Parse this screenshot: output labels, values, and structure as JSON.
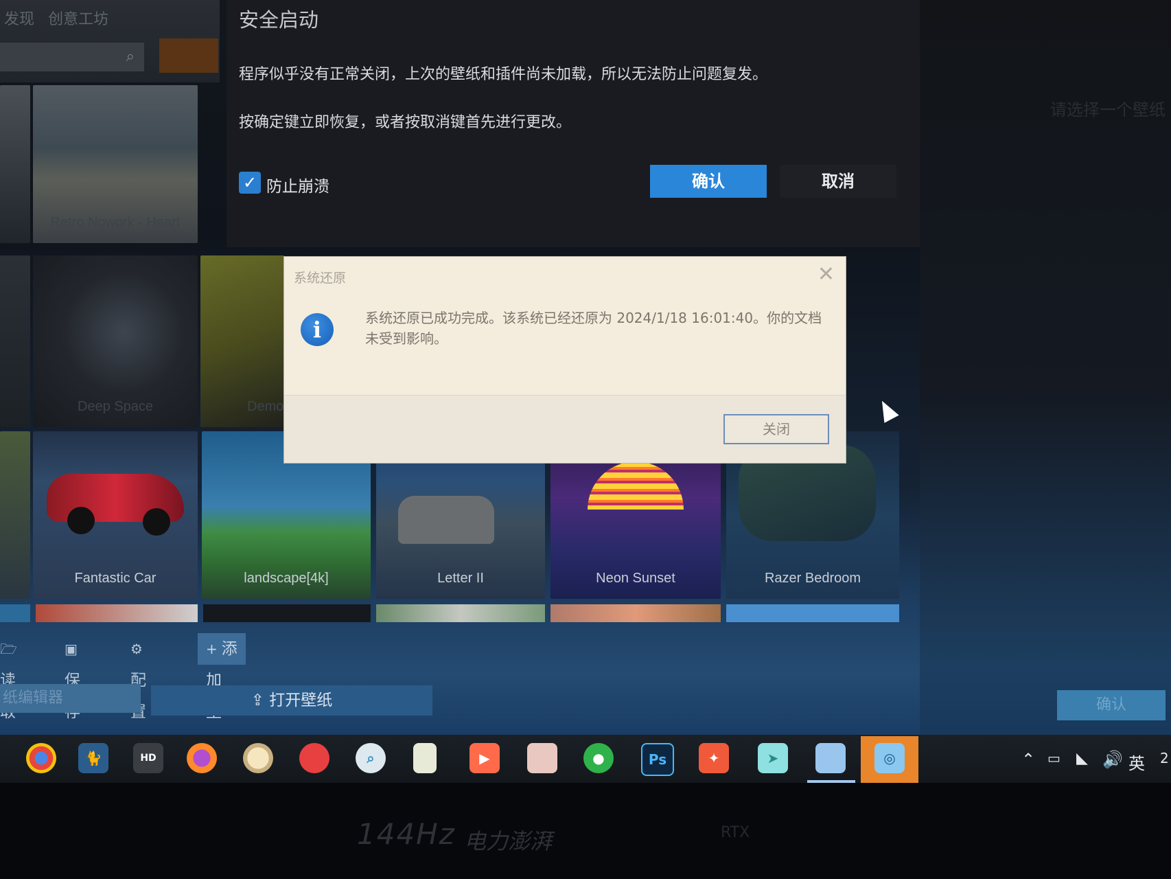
{
  "library": {
    "tab_label": "发现",
    "tab2_label": "创意工坊",
    "tiles_row1": [
      {
        "label": "Retro Nowork - Heart"
      },
      {
        "label": ""
      }
    ],
    "tiles_row2": [
      {
        "label": "Deep Space"
      },
      {
        "label": "Demo"
      }
    ],
    "tiles_row3": [
      {
        "label": "Fantastic Car"
      },
      {
        "label": "landscape[4k]"
      },
      {
        "label": "Letter II"
      },
      {
        "label": "Neon Sunset"
      },
      {
        "label": "Razer Bedroom"
      }
    ]
  },
  "safe_start": {
    "title": "安全启动",
    "message1": "程序似乎没有正常关闭，上次的壁纸和插件尚未加载，所以无法防止问题复发。",
    "message2": "按确定键立即恢复，或者按取消键首先进行更改。",
    "checkbox_label": "防止崩溃",
    "checkbox_checked": true,
    "ok_label": "确认",
    "cancel_label": "取消"
  },
  "restore_dialog": {
    "caption": "系统还原",
    "message": "系统还原已成功完成。该系统已经还原为 2024/1/18 16:01:40。你的文档未受到影响。",
    "close_label": "关闭"
  },
  "toolbar": {
    "read_label": "读取",
    "save_label": "保存",
    "config_label": "配置",
    "add_label": "添加壁纸",
    "editor_label": "纸编辑器",
    "open_label": "打开壁纸",
    "confirm_label": "确认"
  },
  "right_panel": {
    "hint": "请选择一个壁纸"
  },
  "taskbar": {
    "tray_ime": "英",
    "tray_clock": "2"
  },
  "monitor": {
    "refresh": "144Hz",
    "slogan": "电力澎湃",
    "rtx": "RTX"
  },
  "colors": {
    "accent": "#2a86d8",
    "dialog_bg": "#f4ecdc",
    "taskbar_active": "#e9862b"
  }
}
